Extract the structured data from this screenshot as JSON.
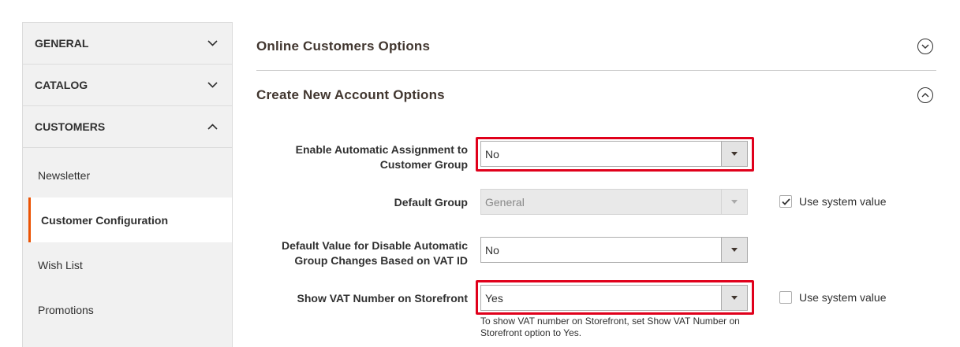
{
  "sidebar": {
    "sections": [
      {
        "label": "GENERAL",
        "expanded": false
      },
      {
        "label": "CATALOG",
        "expanded": false
      },
      {
        "label": "CUSTOMERS",
        "expanded": true
      }
    ],
    "items": [
      {
        "label": "Newsletter",
        "active": false
      },
      {
        "label": "Customer Configuration",
        "active": true
      },
      {
        "label": "Wish List",
        "active": false
      },
      {
        "label": "Promotions",
        "active": false
      }
    ]
  },
  "groups": {
    "online": {
      "title": "Online Customers Options",
      "expanded": false
    },
    "create": {
      "title": "Create New Account Options",
      "expanded": true
    }
  },
  "fields": {
    "auto_assign": {
      "label": "Enable Automatic Assignment to Customer Group",
      "value": "No"
    },
    "default_group": {
      "label": "Default Group",
      "value": "General",
      "use_system_value": true,
      "use_system_label": "Use system value"
    },
    "vat_disable": {
      "label": "Default Value for Disable Automatic Group Changes Based on VAT ID",
      "value": "No"
    },
    "show_vat": {
      "label": "Show VAT Number on Storefront",
      "value": "Yes",
      "use_system_value": false,
      "use_system_label": "Use system value",
      "note": "To show VAT number on Storefront, set Show VAT Number on Storefront option to Yes."
    }
  },
  "colors": {
    "accent": "#eb5202",
    "highlight": "#e0001b"
  }
}
